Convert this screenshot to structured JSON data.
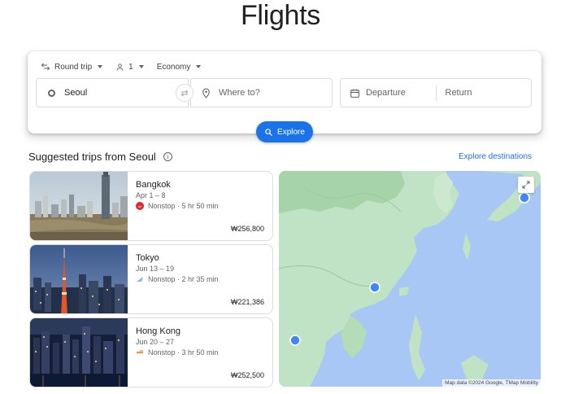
{
  "header": {
    "title": "Flights"
  },
  "search": {
    "trip_type": "Round trip",
    "passengers": "1",
    "cabin_class": "Economy",
    "from_value": "Seoul",
    "to_placeholder": "Where to?",
    "departure_placeholder": "Departure",
    "return_placeholder": "Return",
    "explore_label": "Explore"
  },
  "suggested": {
    "title": "Suggested trips from Seoul",
    "explore_destinations_label": "Explore destinations",
    "trips": [
      {
        "city": "Bangkok",
        "dates": "Apr 1 – 8",
        "flight": "Nonstop · 5 hr 50 min",
        "price": "₩256,800"
      },
      {
        "city": "Tokyo",
        "dates": "Jun 13 – 19",
        "flight": "Nonstop · 2 hr 35 min",
        "price": "₩221,386"
      },
      {
        "city": "Hong Kong",
        "dates": "Jun 20 – 27",
        "flight": "Nonstop · 3 hr 50 min",
        "price": "₩252,500"
      }
    ]
  },
  "map": {
    "attribution": "Map data ©2024 Google, TMap Mobility"
  },
  "colors": {
    "accent": "#1a73e8",
    "map_water": "#a9c7f5",
    "map_land": "#bfe3c4",
    "pin": "#4285f4"
  },
  "icons": {
    "trip_type": "swap-arrows-icon",
    "passengers": "person-icon",
    "from": "circle-icon",
    "to": "location-pin-icon",
    "date": "calendar-icon",
    "explore": "search-icon",
    "info": "info-icon",
    "expand": "expand-icon"
  }
}
